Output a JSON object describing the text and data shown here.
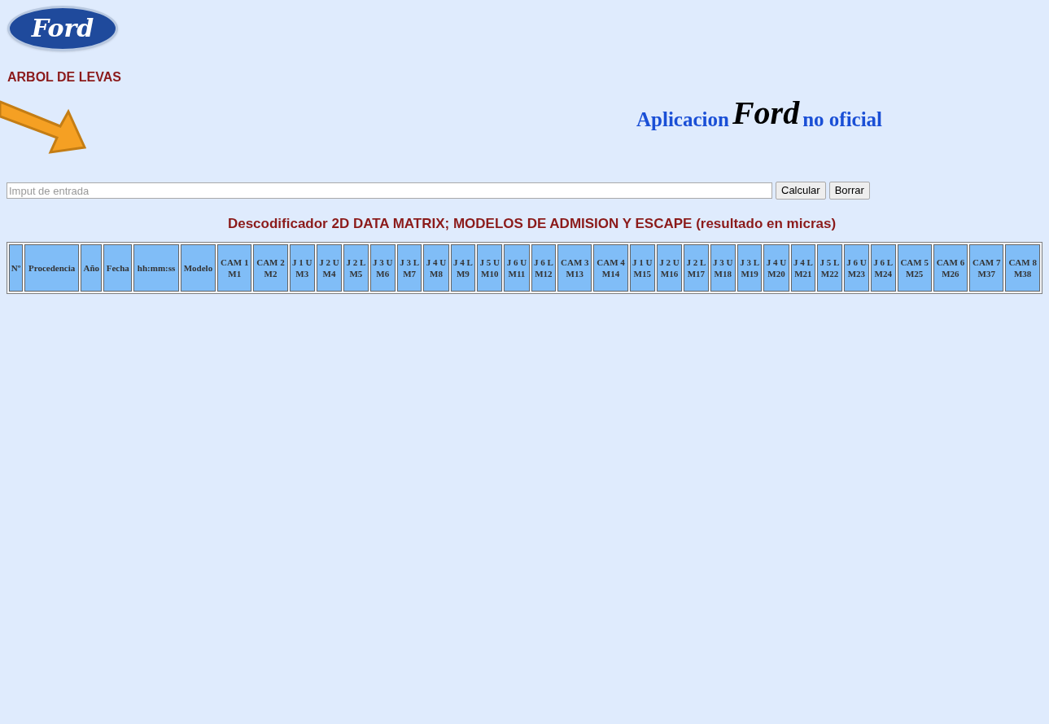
{
  "logo": {
    "text": "Ford"
  },
  "page_title": "ARBOL DE LEVAS",
  "banner": {
    "before": "Aplicacion",
    "brand": "Ford",
    "after": "no oficial"
  },
  "input": {
    "placeholder": "Imput de entrada"
  },
  "buttons": [
    "Calcular",
    "Borrar"
  ],
  "table_title": "Descodificador 2D DATA MATRIX; MODELOS DE ADMISION Y ESCAPE (resultado en micras)",
  "table": {
    "columns": [
      {
        "lines": [
          "Nº"
        ]
      },
      {
        "lines": [
          "Procedencia"
        ]
      },
      {
        "lines": [
          "Año"
        ]
      },
      {
        "lines": [
          "Fecha"
        ]
      },
      {
        "lines": [
          "hh:mm:ss"
        ]
      },
      {
        "lines": [
          "Modelo"
        ]
      },
      {
        "lines": [
          "CAM 1",
          "M1"
        ]
      },
      {
        "lines": [
          "CAM 2",
          "M2"
        ]
      },
      {
        "lines": [
          "J 1 U",
          "M3"
        ]
      },
      {
        "lines": [
          "J 2 U",
          "M4"
        ]
      },
      {
        "lines": [
          "J 2 L",
          "M5"
        ]
      },
      {
        "lines": [
          "J 3 U",
          "M6"
        ]
      },
      {
        "lines": [
          "J 3 L",
          "M7"
        ]
      },
      {
        "lines": [
          "J 4 U",
          "M8"
        ]
      },
      {
        "lines": [
          "J 4 L",
          "M9"
        ]
      },
      {
        "lines": [
          "J 5 U",
          "M10"
        ]
      },
      {
        "lines": [
          "J 6 U",
          "M11"
        ]
      },
      {
        "lines": [
          "J 6 L",
          "M12"
        ]
      },
      {
        "lines": [
          "CAM 3",
          "M13"
        ]
      },
      {
        "lines": [
          "CAM 4",
          "M14"
        ]
      },
      {
        "lines": [
          "J 1 U",
          "M15"
        ]
      },
      {
        "lines": [
          "J 2 U",
          "M16"
        ]
      },
      {
        "lines": [
          "J 2 L",
          "M17"
        ]
      },
      {
        "lines": [
          "J 3 U",
          "M18"
        ]
      },
      {
        "lines": [
          "J 3 L",
          "M19"
        ]
      },
      {
        "lines": [
          "J 4 U",
          "M20"
        ]
      },
      {
        "lines": [
          "J 4 L",
          "M21"
        ]
      },
      {
        "lines": [
          "J 5 L",
          "M22"
        ]
      },
      {
        "lines": [
          "J 6 U",
          "M23"
        ]
      },
      {
        "lines": [
          "J 6 L",
          "M24"
        ]
      },
      {
        "lines": [
          "CAM 5",
          "M25"
        ]
      },
      {
        "lines": [
          "CAM 6",
          "M26"
        ]
      },
      {
        "lines": [
          "CAM 7",
          "M37"
        ]
      },
      {
        "lines": [
          "CAM 8",
          "M38"
        ]
      }
    ]
  }
}
